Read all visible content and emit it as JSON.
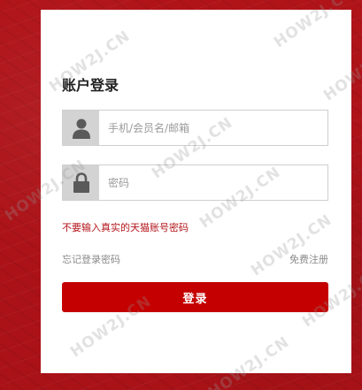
{
  "form": {
    "title": "账户登录",
    "username_placeholder": "手机/会员名/邮箱",
    "password_placeholder": "密码",
    "warning": "不要输入真实的天猫账号密码",
    "forgot_link": "忘记登录密码",
    "register_link": "免费注册",
    "login_button": "登录"
  },
  "watermark": {
    "text": "HOW2J.CN"
  },
  "icons": {
    "username": "user-icon",
    "password": "lock-icon"
  },
  "colors": {
    "background": "#b5161b",
    "accent": "#c40000",
    "warning_text": "#b3151a"
  }
}
